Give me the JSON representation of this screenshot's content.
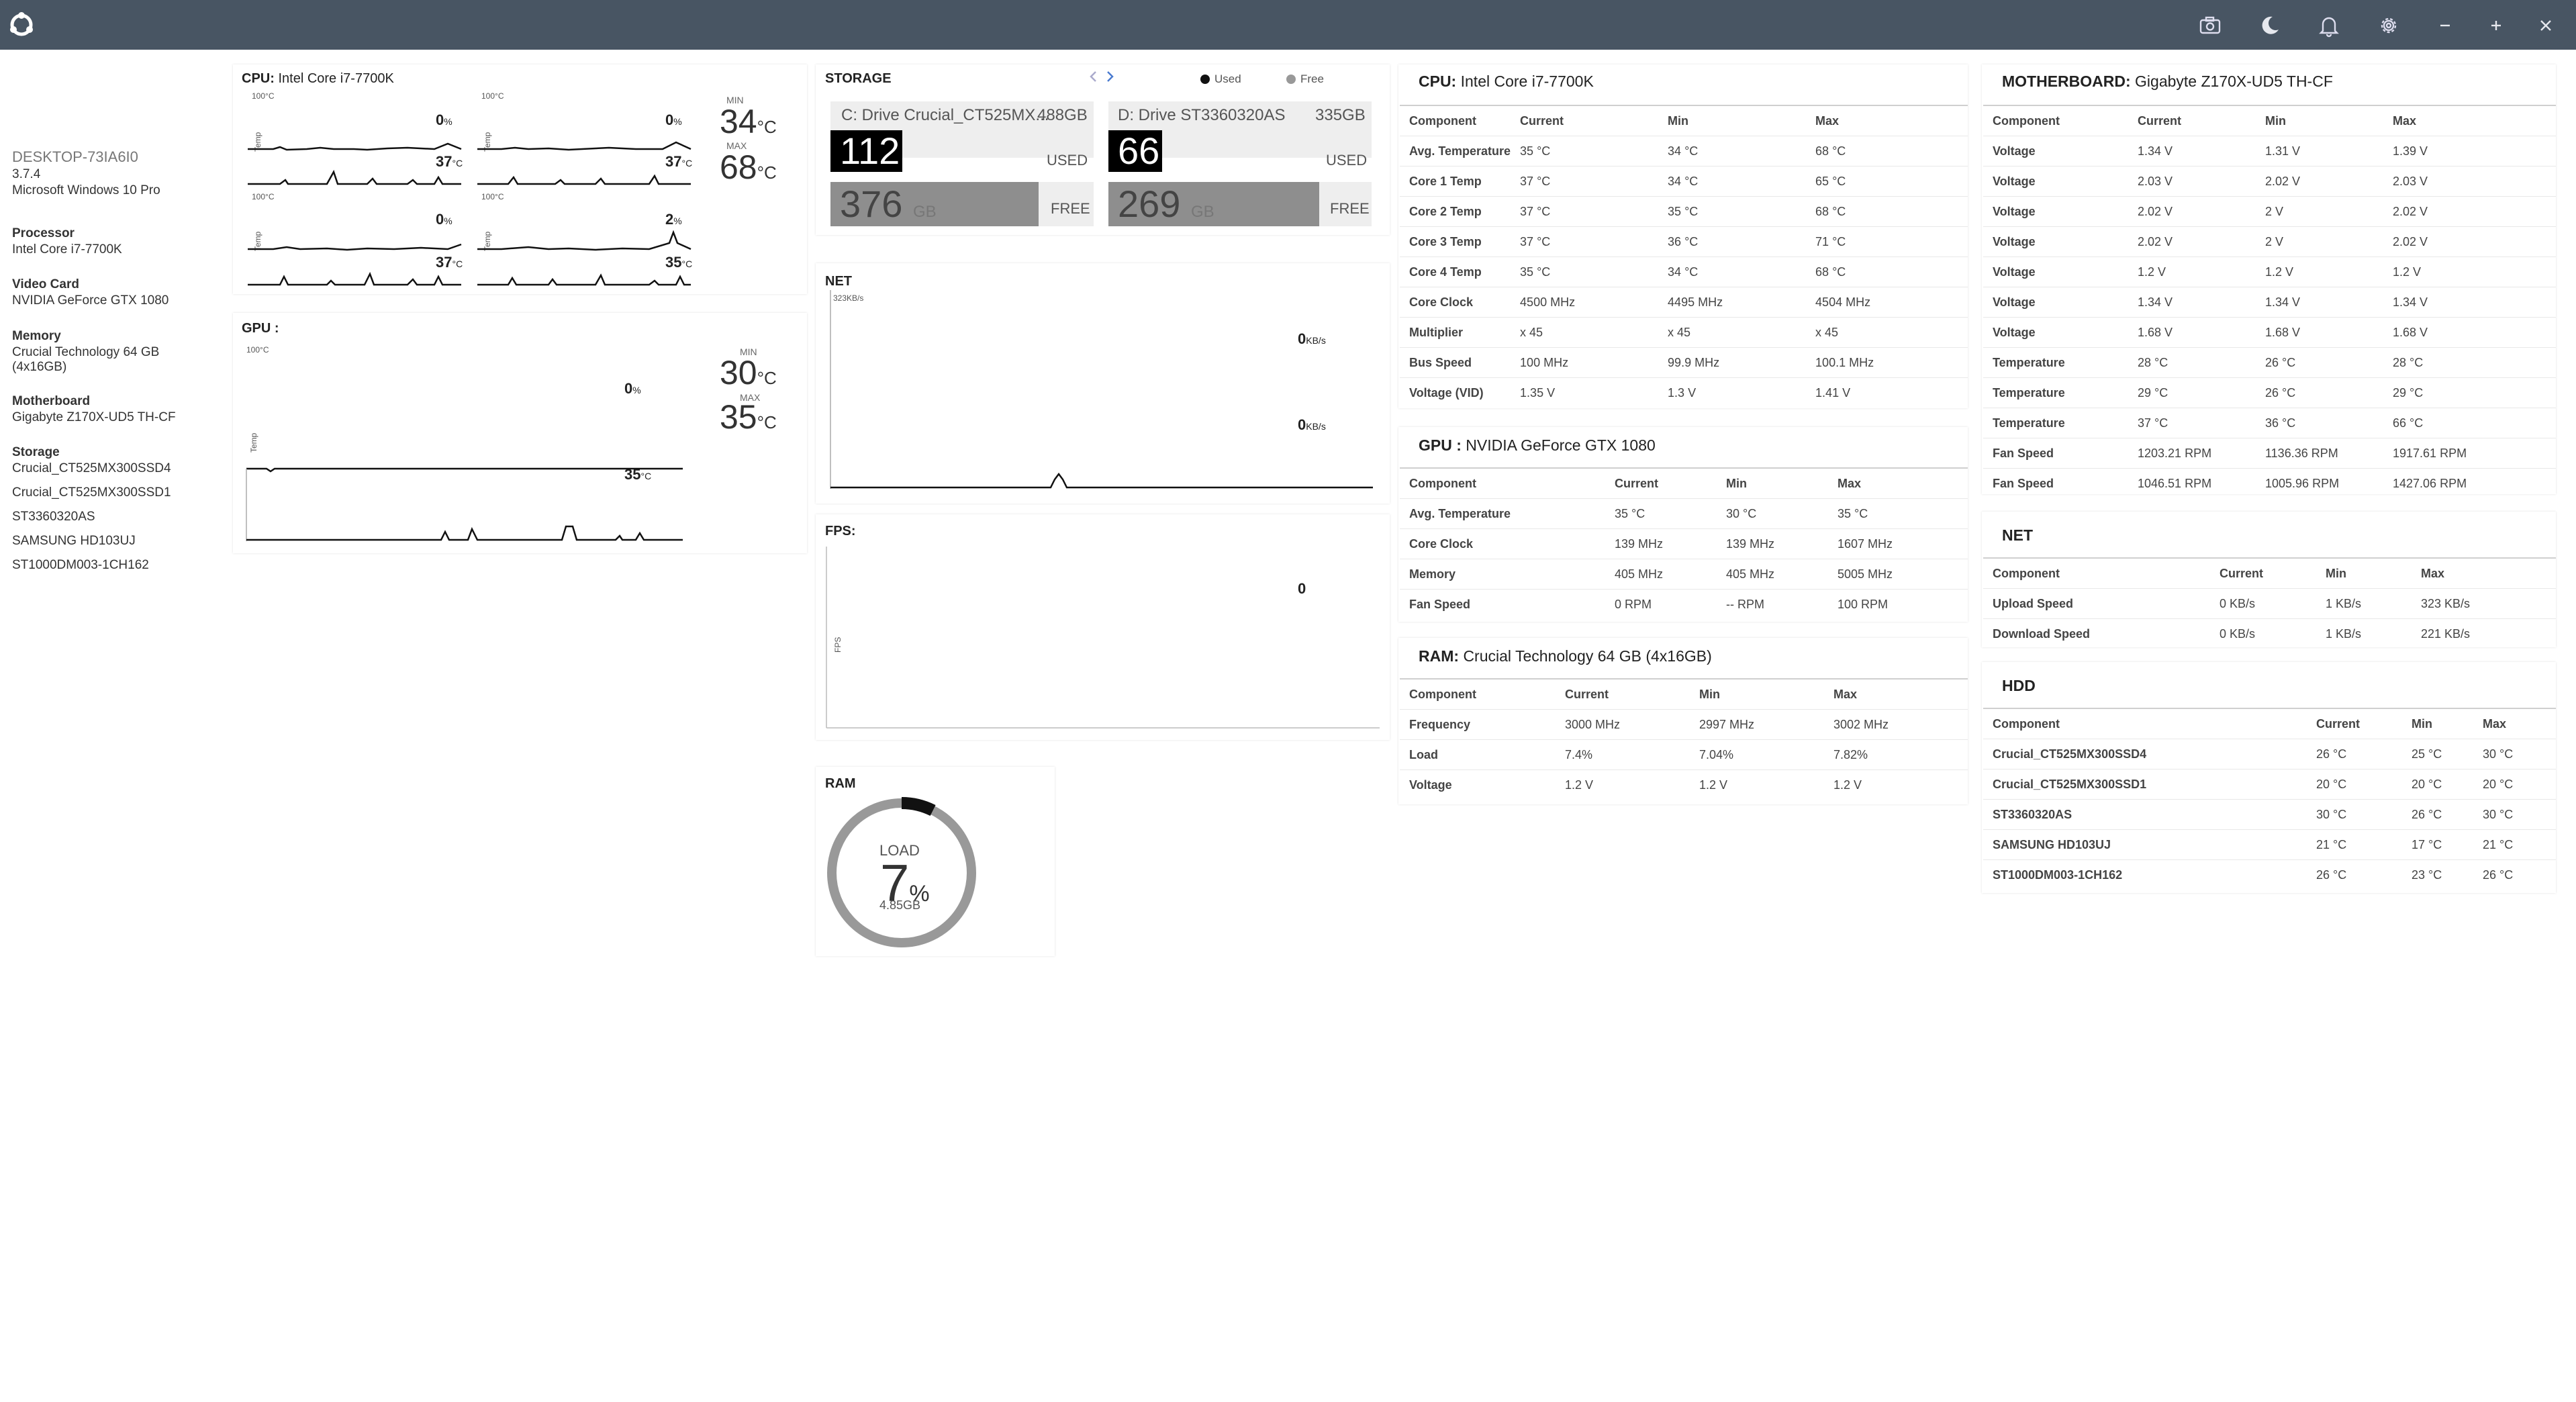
{
  "titlebar": {
    "icons": [
      "app-logo-icon",
      "camera-icon",
      "moon-icon",
      "bell-icon",
      "gear-icon",
      "minimize-icon",
      "maximize-icon",
      "close-icon"
    ]
  },
  "sidebar": {
    "hostname": "DESKTOP-73IA6I0",
    "version": "3.7.4",
    "os": "Microsoft Windows 10 Pro",
    "processor_label": "Processor",
    "processor": "Intel Core i7-7700K",
    "video_label": "Video Card",
    "video": "NVIDIA GeForce GTX 1080",
    "memory_label": "Memory",
    "memory_line1": "Crucial Technology 64 GB",
    "memory_line2": "(4x16GB)",
    "motherboard_label": "Motherboard",
    "motherboard": "Gigabyte Z170X-UD5 TH-CF",
    "storage_label": "Storage",
    "storage": [
      "Crucial_CT525MX300SSD4",
      "Crucial_CT525MX300SSD1",
      "ST3360320AS",
      "SAMSUNG HD103UJ",
      "ST1000DM003-1CH162"
    ]
  },
  "cpu_panel": {
    "title": "CPU:",
    "name": "Intel Core i7-7700K",
    "axis_max": "100°C",
    "axis_label": "Temp",
    "cores": [
      {
        "pct": "0",
        "temp": "37"
      },
      {
        "pct": "0",
        "temp": "37"
      },
      {
        "pct": "0",
        "temp": "37"
      },
      {
        "pct": "2",
        "temp": "35"
      }
    ],
    "pct_unit": "%",
    "temp_unit": "°C",
    "min_label": "MIN",
    "max_label": "MAX",
    "min": "34",
    "max": "68"
  },
  "gpu_panel": {
    "title": "GPU :",
    "axis_max": "100°C",
    "axis_label": "Temp",
    "pct": "0",
    "pct_unit": "%",
    "temp": "35",
    "temp_unit": "°C",
    "min_label": "MIN",
    "max_label": "MAX",
    "min": "30",
    "max": "35"
  },
  "storage_panel": {
    "title": "STORAGE",
    "legend_used": "Used",
    "legend_free": "Free",
    "used_label": "USED",
    "free_label": "FREE",
    "unit": "GB",
    "drives": [
      {
        "label": "C: Drive Crucial_CT525MX...",
        "size": "488GB",
        "used": "112",
        "free": "376"
      },
      {
        "label": "D: Drive ST3360320AS",
        "size": "335GB",
        "used": "66",
        "free": "269"
      }
    ]
  },
  "net_panel": {
    "title": "NET",
    "axis_max": "323KB/s",
    "up": "0",
    "down": "0",
    "unit": "KB/s"
  },
  "fps_panel": {
    "title": "FPS:",
    "value": "0",
    "axis_label": "FPS"
  },
  "ram_panel": {
    "title": "RAM",
    "load_label": "LOAD",
    "load": "7",
    "unit": "%",
    "used": "4.85GB",
    "load_fraction": 0.074
  },
  "cpu_table": {
    "title": "CPU:",
    "name": "Intel Core i7-7700K",
    "headers": [
      "Component",
      "Current",
      "Min",
      "Max"
    ],
    "rows": [
      [
        "Avg. Temperature",
        "35 °C",
        "34 °C",
        "68 °C"
      ],
      [
        "Core 1 Temp",
        "37 °C",
        "34 °C",
        "65 °C"
      ],
      [
        "Core 2 Temp",
        "37 °C",
        "35 °C",
        "68 °C"
      ],
      [
        "Core 3 Temp",
        "37 °C",
        "36 °C",
        "71 °C"
      ],
      [
        "Core 4 Temp",
        "35 °C",
        "34 °C",
        "68 °C"
      ],
      [
        "Core Clock",
        "4500 MHz",
        "4495 MHz",
        "4504 MHz"
      ],
      [
        "Multiplier",
        "x 45",
        "x 45",
        "x 45"
      ],
      [
        "Bus Speed",
        "100 MHz",
        "99.9 MHz",
        "100.1 MHz"
      ],
      [
        "Voltage (VID)",
        "1.35 V",
        "1.3 V",
        "1.41 V"
      ]
    ]
  },
  "gpu_table": {
    "title": "GPU :",
    "name": "NVIDIA GeForce GTX 1080",
    "headers": [
      "Component",
      "Current",
      "Min",
      "Max"
    ],
    "rows": [
      [
        "Avg. Temperature",
        "35 °C",
        "30 °C",
        "35 °C"
      ],
      [
        "Core Clock",
        "139 MHz",
        "139 MHz",
        "1607 MHz"
      ],
      [
        "Memory",
        "405 MHz",
        "405 MHz",
        "5005 MHz"
      ],
      [
        "Fan Speed",
        "0 RPM",
        "-- RPM",
        "100 RPM"
      ]
    ]
  },
  "ram_table": {
    "title": "RAM:",
    "name": "Crucial Technology 64 GB (4x16GB)",
    "headers": [
      "Component",
      "Current",
      "Min",
      "Max"
    ],
    "rows": [
      [
        "Frequency",
        "3000 MHz",
        "2997 MHz",
        "3002 MHz"
      ],
      [
        "Load",
        "7.4%",
        "7.04%",
        "7.82%"
      ],
      [
        "Voltage",
        "1.2 V",
        "1.2 V",
        "1.2 V"
      ]
    ]
  },
  "mb_table": {
    "title": "MOTHERBOARD:",
    "name": "Gigabyte Z170X-UD5 TH-CF",
    "headers": [
      "Component",
      "Current",
      "Min",
      "Max"
    ],
    "rows": [
      [
        "Voltage",
        "1.34 V",
        "1.31 V",
        "1.39 V"
      ],
      [
        "Voltage",
        "2.03 V",
        "2.02 V",
        "2.03 V"
      ],
      [
        "Voltage",
        "2.02 V",
        "2 V",
        "2.02 V"
      ],
      [
        "Voltage",
        "2.02 V",
        "2 V",
        "2.02 V"
      ],
      [
        "Voltage",
        "1.2 V",
        "1.2 V",
        "1.2 V"
      ],
      [
        "Voltage",
        "1.34 V",
        "1.34 V",
        "1.34 V"
      ],
      [
        "Voltage",
        "1.68 V",
        "1.68 V",
        "1.68 V"
      ],
      [
        "Temperature",
        "28 °C",
        "26 °C",
        "28 °C"
      ],
      [
        "Temperature",
        "29 °C",
        "26 °C",
        "29 °C"
      ],
      [
        "Temperature",
        "37 °C",
        "36 °C",
        "66 °C"
      ],
      [
        "Fan Speed",
        "1203.21 RPM",
        "1136.36 RPM",
        "1917.61 RPM"
      ],
      [
        "Fan Speed",
        "1046.51 RPM",
        "1005.96 RPM",
        "1427.06 RPM"
      ]
    ]
  },
  "net_table": {
    "title": "NET",
    "headers": [
      "Component",
      "Current",
      "Min",
      "Max"
    ],
    "rows": [
      [
        "Upload Speed",
        "0 KB/s",
        "1 KB/s",
        "323 KB/s"
      ],
      [
        "Download Speed",
        "0 KB/s",
        "1 KB/s",
        "221 KB/s"
      ]
    ]
  },
  "hdd_table": {
    "title": "HDD",
    "headers": [
      "Component",
      "Current",
      "Min",
      "Max"
    ],
    "rows": [
      [
        "Crucial_CT525MX300SSD4",
        "26 °C",
        "25 °C",
        "30 °C"
      ],
      [
        "Crucial_CT525MX300SSD1",
        "20 °C",
        "20 °C",
        "20 °C"
      ],
      [
        "ST3360320AS",
        "30 °C",
        "26 °C",
        "30 °C"
      ],
      [
        "SAMSUNG HD103UJ",
        "21 °C",
        "17 °C",
        "21 °C"
      ],
      [
        "ST1000DM003-1CH162",
        "26 °C",
        "23 °C",
        "26 °C"
      ]
    ]
  }
}
